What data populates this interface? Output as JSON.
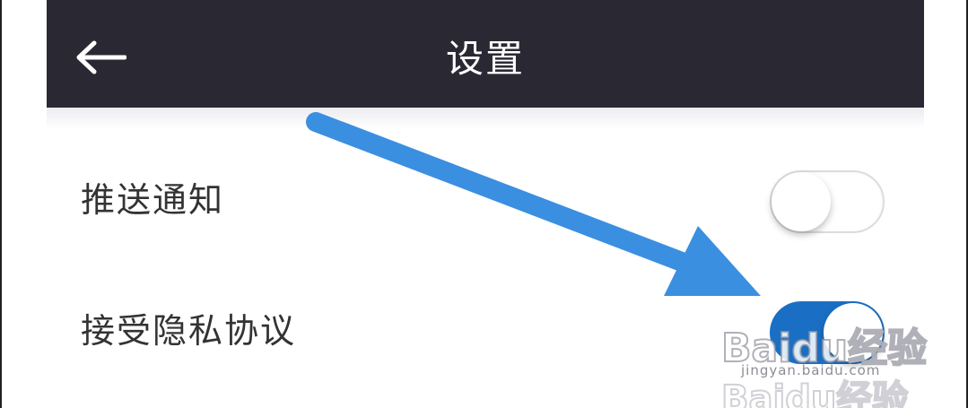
{
  "header": {
    "title": "设置",
    "back_icon": "arrow-left-icon",
    "background": "#2a2833"
  },
  "settings": [
    {
      "label": "推送通知",
      "enabled": false
    },
    {
      "label": "接受隐私协议",
      "enabled": true
    }
  ],
  "colors": {
    "toggle_on": "#1a6fc4",
    "annotation_arrow": "#3a8fe0"
  },
  "watermark": {
    "logo_text": "Baidu经验",
    "url": "jingyan.baidu.com"
  }
}
